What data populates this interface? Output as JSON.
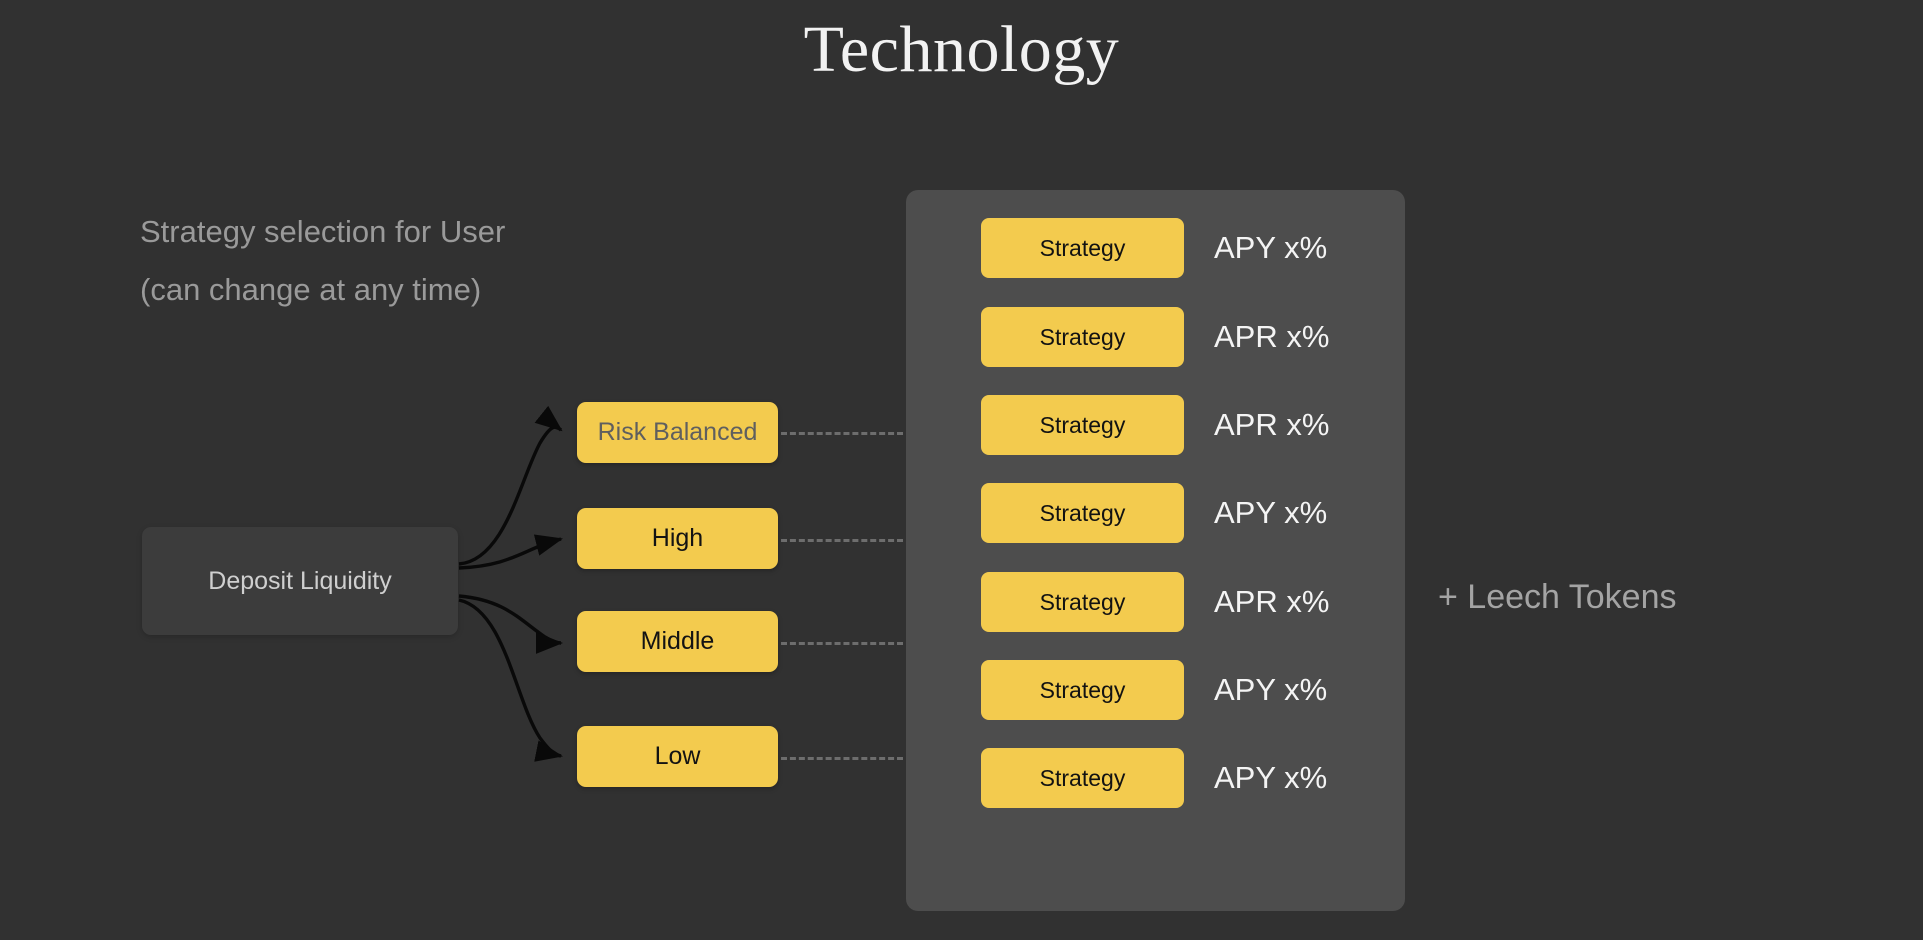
{
  "slide": {
    "title": "Technology",
    "background_color": "#313131",
    "accent_color": "#f3cb4e"
  },
  "caption": {
    "line1": "Strategy selection for User",
    "line2": "(can change at any time)"
  },
  "deposit": {
    "label": "Deposit Liquidity"
  },
  "risk_levels": [
    {
      "label": "Risk Balanced"
    },
    {
      "label": "High"
    },
    {
      "label": "Middle"
    },
    {
      "label": "Low"
    }
  ],
  "strategy_panel": {
    "rows": [
      {
        "chip": "Strategy",
        "rate": "APY x%"
      },
      {
        "chip": "Strategy",
        "rate": "APR x%"
      },
      {
        "chip": "Strategy",
        "rate": "APR x%"
      },
      {
        "chip": "Strategy",
        "rate": "APY x%"
      },
      {
        "chip": "Strategy",
        "rate": "APR x%"
      },
      {
        "chip": "Strategy",
        "rate": "APY x%"
      },
      {
        "chip": "Strategy",
        "rate": "APY x%"
      }
    ]
  },
  "leech": {
    "label": "+ Leech Tokens"
  }
}
